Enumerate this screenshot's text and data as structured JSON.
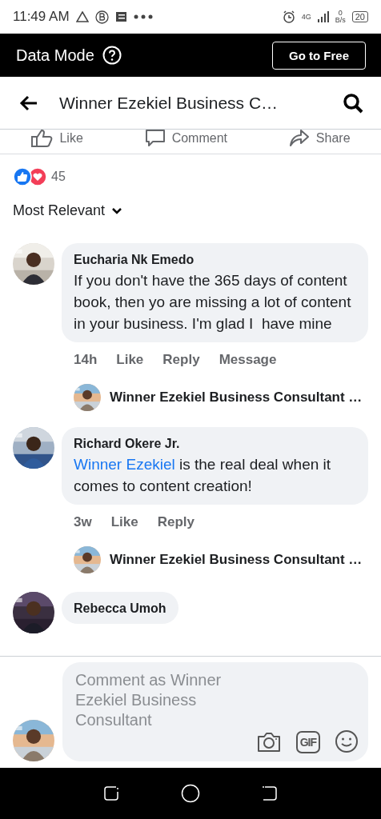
{
  "status_bar": {
    "time": "11:49 AM",
    "network": "4G",
    "speed_value": "0",
    "speed_unit": "B/s",
    "battery": "20"
  },
  "data_mode": {
    "label": "Data Mode",
    "button": "Go to Free"
  },
  "header": {
    "title": "Winner Ezekiel Business C…"
  },
  "post_actions": [
    {
      "kind": "like",
      "label": "Like"
    },
    {
      "kind": "comment",
      "label": "Comment"
    },
    {
      "kind": "share",
      "label": "Share"
    }
  ],
  "reactions": {
    "count": "45"
  },
  "sort": {
    "label": "Most Relevant"
  },
  "comments": [
    {
      "author": "Eucharia Nk Emedo",
      "text": "If you don't have the 365 days of content book, then yo are missing a lot of content in your business. I'm glad I  have mine",
      "actions": [
        "14h",
        "Like",
        "Reply",
        "Message"
      ],
      "reply_preview": "Winner Ezekiel Business Consultant …"
    },
    {
      "author": "Richard Okere Jr.",
      "mention": "Winner Ezekiel",
      "text": " is the real deal when it comes to content creation!",
      "actions": [
        "3w",
        "Like",
        "Reply"
      ],
      "reply_preview": "Winner Ezekiel Business Consultant …"
    },
    {
      "author": "Rebecca Umoh"
    }
  ],
  "composer": {
    "placeholder": "Comment as Winner Ezekiel Business Consultant",
    "gif": "GIF"
  }
}
